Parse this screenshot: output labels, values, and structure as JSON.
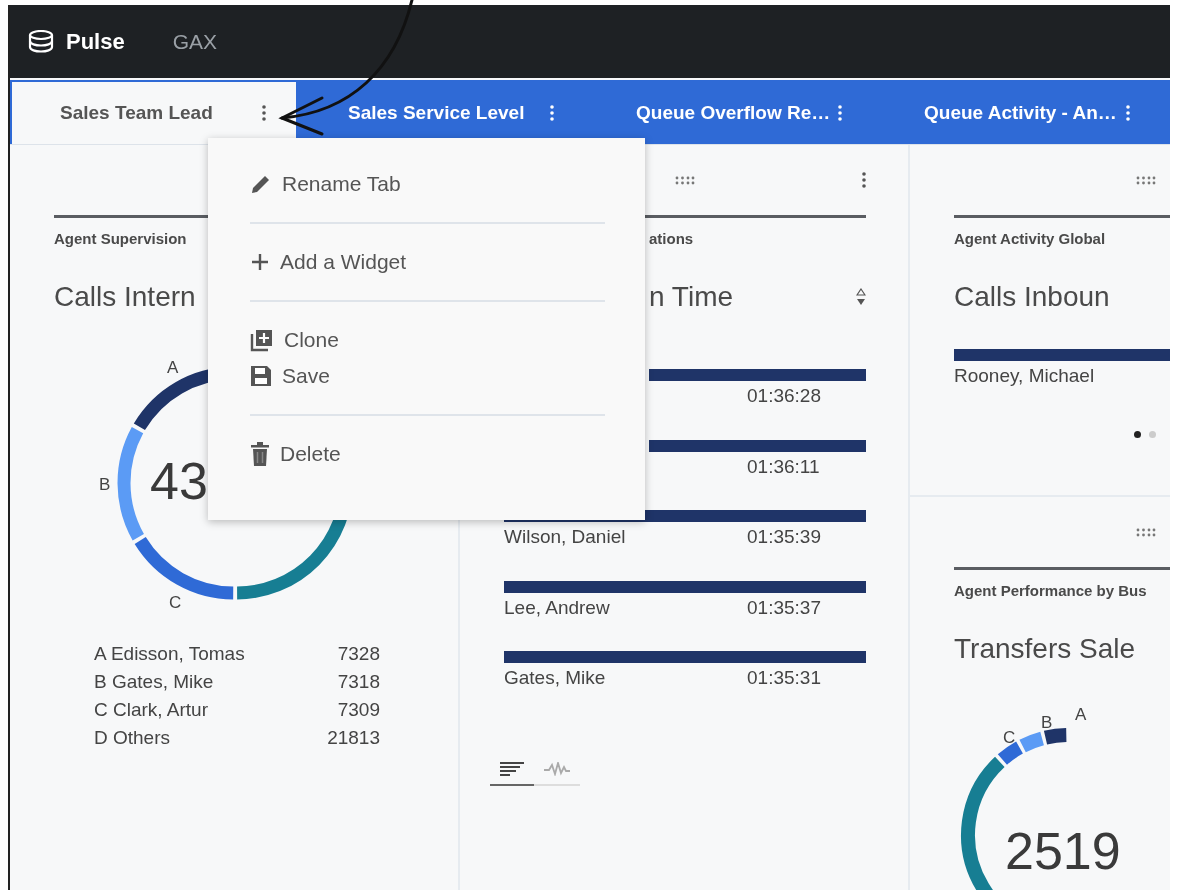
{
  "app": {
    "name": "Pulse",
    "section": "GAX"
  },
  "tabs": [
    {
      "label": "Sales Team Lead",
      "selected": true
    },
    {
      "label": "Sales Service Level",
      "selected": false
    },
    {
      "label": "Queue Overflow Re…",
      "selected": false
    },
    {
      "label": "Queue Activity - An…",
      "selected": false
    }
  ],
  "tab_menu": {
    "items": [
      {
        "label": "Rename Tab",
        "divider_after": true
      },
      {
        "label": "Add a Widget",
        "divider_after": true
      },
      {
        "label": "Clone",
        "divider_after": false
      },
      {
        "label": "Save",
        "divider_after": true
      },
      {
        "label": "Delete",
        "divider_after": false
      }
    ]
  },
  "left_widget": {
    "subtitle": "Agent Supervision",
    "title": "Calls Intern",
    "total": "43",
    "slice_labels": [
      "A",
      "B",
      "C"
    ],
    "legend": [
      {
        "label": "A Edisson, Tomas",
        "value": "7328"
      },
      {
        "label": "B Gates, Mike",
        "value": "7318"
      },
      {
        "label": "C Clark, Artur",
        "value": "7309"
      },
      {
        "label": "D Others",
        "value": "21813"
      }
    ]
  },
  "middle_widget": {
    "subtitle": "ations",
    "title": "n Time",
    "rows": [
      {
        "time": "01:36:28"
      },
      {
        "time": "01:36:11"
      },
      {
        "name": "Wilson, Daniel",
        "time": "01:35:39"
      },
      {
        "name": "Lee, Andrew",
        "time": "01:35:37"
      },
      {
        "name": "Gates, Mike",
        "time": "01:35:31"
      }
    ],
    "view_toggle": [
      {
        "kind": "bars",
        "selected": true
      },
      {
        "kind": "wave",
        "selected": false
      }
    ]
  },
  "right_top_widget": {
    "subtitle": "Agent Activity Global",
    "title": "Calls Inboun",
    "rows": [
      {
        "name": "Rooney, Michael"
      }
    ],
    "pages": [
      {
        "selected": true
      },
      {
        "selected": false
      }
    ]
  },
  "right_bottom_widget": {
    "subtitle": "Agent Performance by Bus",
    "title": "Transfers Sale",
    "total": "2519",
    "slice_labels": [
      "C",
      "B",
      "A"
    ]
  }
}
